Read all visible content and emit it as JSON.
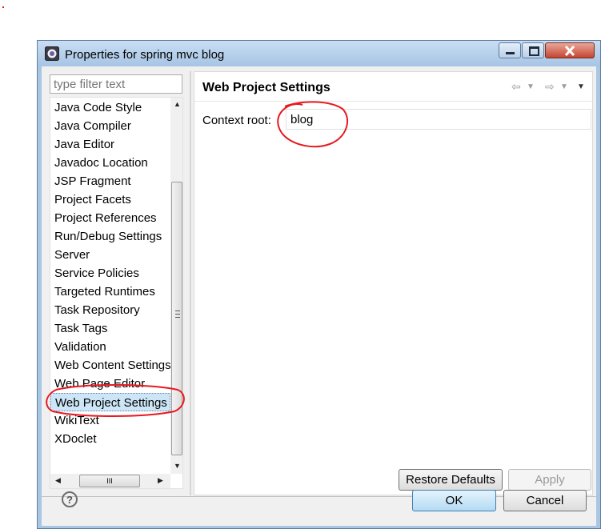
{
  "window": {
    "title": "Properties for spring mvc blog",
    "buttons": [
      "minimize",
      "maximize",
      "close"
    ]
  },
  "filter": {
    "placeholder": "type filter text"
  },
  "tree": {
    "items": [
      {
        "label": "Java Code Style",
        "selected": false
      },
      {
        "label": "Java Compiler",
        "selected": false
      },
      {
        "label": "Java Editor",
        "selected": false
      },
      {
        "label": "Javadoc Location",
        "selected": false
      },
      {
        "label": "JSP Fragment",
        "selected": false
      },
      {
        "label": "Project Facets",
        "selected": false
      },
      {
        "label": "Project References",
        "selected": false
      },
      {
        "label": "Run/Debug Settings",
        "selected": false
      },
      {
        "label": "Server",
        "selected": false
      },
      {
        "label": "Service Policies",
        "selected": false
      },
      {
        "label": "Targeted Runtimes",
        "selected": false
      },
      {
        "label": "Task Repository",
        "selected": false
      },
      {
        "label": "Task Tags",
        "selected": false
      },
      {
        "label": "Validation",
        "selected": false
      },
      {
        "label": "Web Content Settings",
        "selected": false
      },
      {
        "label": "Web Page Editor",
        "selected": false
      },
      {
        "label": "Web Project Settings",
        "selected": true
      },
      {
        "label": "WikiText",
        "selected": false
      },
      {
        "label": "XDoclet",
        "selected": false
      }
    ]
  },
  "page": {
    "title": "Web Project Settings",
    "context_root_label": "Context root:",
    "context_root_value": "blog"
  },
  "buttons": {
    "restore_defaults": "Restore Defaults",
    "apply": "Apply",
    "ok": "OK",
    "cancel": "Cancel",
    "help": "?"
  },
  "colors": {
    "selection": "#cde6f7",
    "annotation": "#e8191f",
    "titlebar": "#a9c6e3"
  }
}
